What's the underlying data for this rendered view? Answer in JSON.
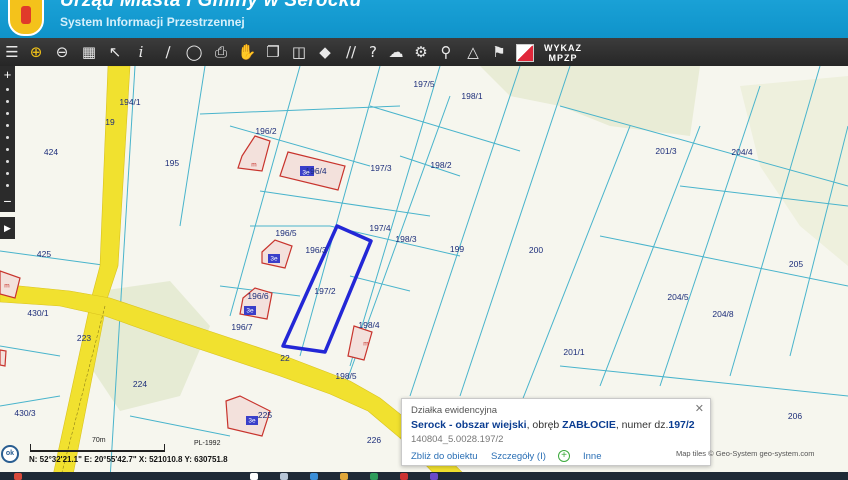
{
  "header": {
    "title": "Urząd Miasta i Gminy w Serocku",
    "subtitle": "System Informacji Przestrzennej"
  },
  "toolbar": {
    "icons": [
      "layers-icon",
      "zoom-in-icon",
      "zoom-out-icon",
      "zoom-extent-icon",
      "pointer-icon",
      "info-icon",
      "measure-line-icon",
      "measure-area-icon",
      "print-icon",
      "pan-icon",
      "copy-icon",
      "layout-icon",
      "pin-icon",
      "hatch-icon",
      "help-icon",
      "cloud-upload-icon",
      "settings-icon",
      "search-icon",
      "triangle-icon",
      "flag-icon"
    ],
    "wykaz_line1": "WYKAZ",
    "wykaz_line2": "MPZP"
  },
  "map": {
    "parcel_labels": [
      "194/1",
      "195",
      "196/2",
      "196/4",
      "196/3",
      "196/5",
      "196/6",
      "196/7",
      "197/3",
      "197/4",
      "197/2",
      "197/5",
      "198/1",
      "198/2",
      "198/3",
      "198/4",
      "198/5",
      "199",
      "200",
      "201/1",
      "201/3",
      "204/4",
      "204/5",
      "204/8",
      "205",
      "206",
      "424",
      "425",
      "430/1",
      "430/3",
      "223",
      "224",
      "225",
      "226",
      "22",
      "19"
    ],
    "building_labels": [
      "3e",
      "3e",
      "3e",
      "3e",
      "m",
      "m",
      "m"
    ],
    "colors": {
      "road": "#f1e12f",
      "parcel_line": "#49b4cc",
      "selected_parcel": "#2327d6",
      "building": "#c8342d",
      "label": "#1d2e7a"
    }
  },
  "popup": {
    "header": "Działka ewidencyjna",
    "place": "Serock - obszar wiejski",
    "precinct_text": ", obręb ",
    "precinct": "ZABŁOCIE",
    "number_text": ", numer dz.",
    "number": "197/2",
    "id": "140804_5.0028.197/2",
    "link_zoom": "Zbliż do obiektu",
    "link_details": "Szczegóły (I)",
    "link_more": "Inne"
  },
  "footer": {
    "ok_label": "ok",
    "scale_label": "70m",
    "crs": "PL-1992",
    "coords": "N: 52°32'21.1\"  E: 20°55'42.7\"  X: 521010.8  Y: 630751.8",
    "attribution": "Map tiles © Geo-System geo-system.com"
  }
}
